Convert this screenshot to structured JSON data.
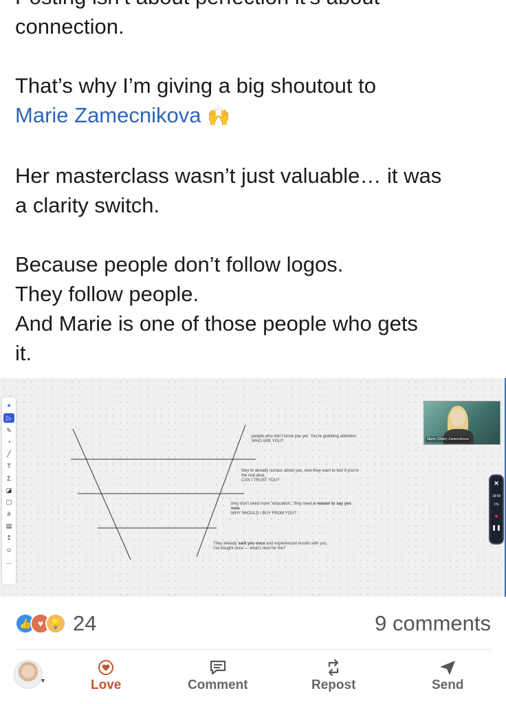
{
  "post": {
    "line0": "Posting isn’t about perfection it’s about",
    "line1": "connection.",
    "p2_text": "That’s why I’m giving a big shoutout to",
    "mention": "Marie Zamecnikova",
    "mention_emoji": "🙌",
    "p3_line1": "Her masterclass wasn’t just valuable… it was",
    "p3_line2": "a clarity switch.",
    "p4_line1": "Because people don’t follow logos.",
    "p4_line2": "They follow people.",
    "p4_line3": "And Marie is one of those people who gets",
    "p4_line4": "it."
  },
  "media": {
    "toolbar_icons": [
      "sparkle-icon",
      "cursor-icon",
      "pen-icon",
      "shapes-icon",
      "line-icon",
      "text-icon",
      "sticky-icon",
      "frame-icon",
      "comment-icon",
      "grid-icon",
      "table-icon",
      "upload-icon",
      "emoji-icon",
      "more-icon"
    ],
    "notes": [
      {
        "text": "people who don’t know you yet. You’re grabbing attention.",
        "sub": "WHO ARE YOU?"
      },
      {
        "text": "they’re already curious about you, now they want to test if you’re the real deal.",
        "sub": "CAN I TRUST YOU?"
      },
      {
        "pre": "they don’t need more “education,” they need ",
        "bold": "a reason to say yes now.",
        "sub": "WHY SHOULD I BUY FROM YOU?"
      },
      {
        "pre": "They already ",
        "bold": "said yes once",
        "post": " and experienced results with you.",
        "sub": "I’ve bought once — what’s next for me?"
      }
    ],
    "video_name": "Marie (Olivie) Zamecnikova",
    "recording": {
      "time": "18:55",
      "people": "1%"
    }
  },
  "social": {
    "reaction_count": "24",
    "comments": "9 comments",
    "reaction_icons": [
      "like-icon",
      "love-icon",
      "insightful-icon"
    ]
  },
  "actions": {
    "love": "Love",
    "comment": "Comment",
    "repost": "Repost",
    "send": "Send"
  },
  "colors": {
    "mention": "#2f64b8",
    "love": "#c5532d",
    "like": "#378fe9"
  }
}
